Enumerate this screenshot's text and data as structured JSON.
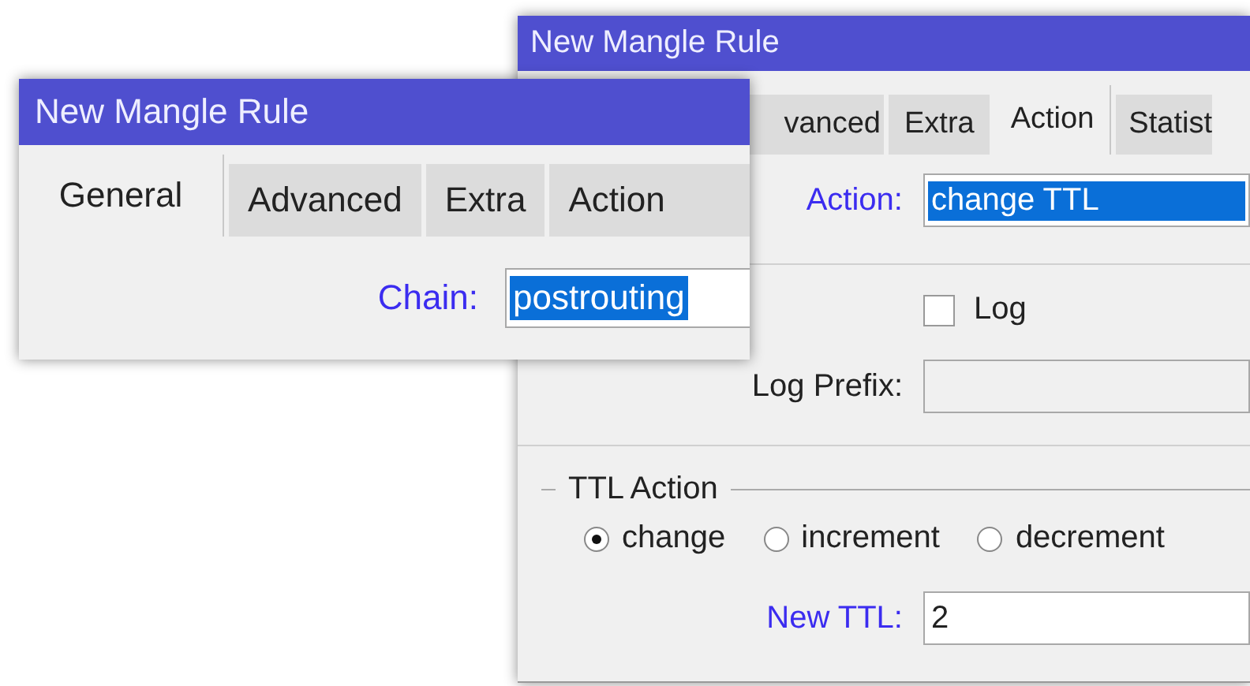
{
  "rear_window": {
    "title": "New Mangle Rule",
    "tabs": [
      {
        "label": "vanced",
        "selected": false
      },
      {
        "label": "Extra",
        "selected": false
      },
      {
        "label": "Action",
        "selected": true
      },
      {
        "label": "Statist",
        "selected": false
      }
    ],
    "action": {
      "label": "Action:",
      "emphasis": true,
      "value": "change TTL",
      "value_selected": true
    },
    "log": {
      "label": "Log",
      "checked": false
    },
    "log_prefix": {
      "label": "Log Prefix:",
      "emphasis": false
    },
    "ttl_action": {
      "title": "TTL Action",
      "options": [
        {
          "label": "change",
          "selected": true
        },
        {
          "label": "increment",
          "selected": false
        },
        {
          "label": "decrement",
          "selected": false
        }
      ]
    },
    "new_ttl": {
      "label": "New TTL:",
      "emphasis": true,
      "value": "2",
      "value_selected": false
    }
  },
  "front_window": {
    "title": "New Mangle Rule",
    "tabs": [
      {
        "label": "General",
        "selected": true
      },
      {
        "label": "Advanced",
        "selected": false
      },
      {
        "label": "Extra",
        "selected": false
      },
      {
        "label": "Action",
        "selected": false
      }
    ],
    "chain": {
      "label": "Chain:",
      "emphasis": true,
      "value": "postrouting",
      "value_selected": true
    }
  }
}
